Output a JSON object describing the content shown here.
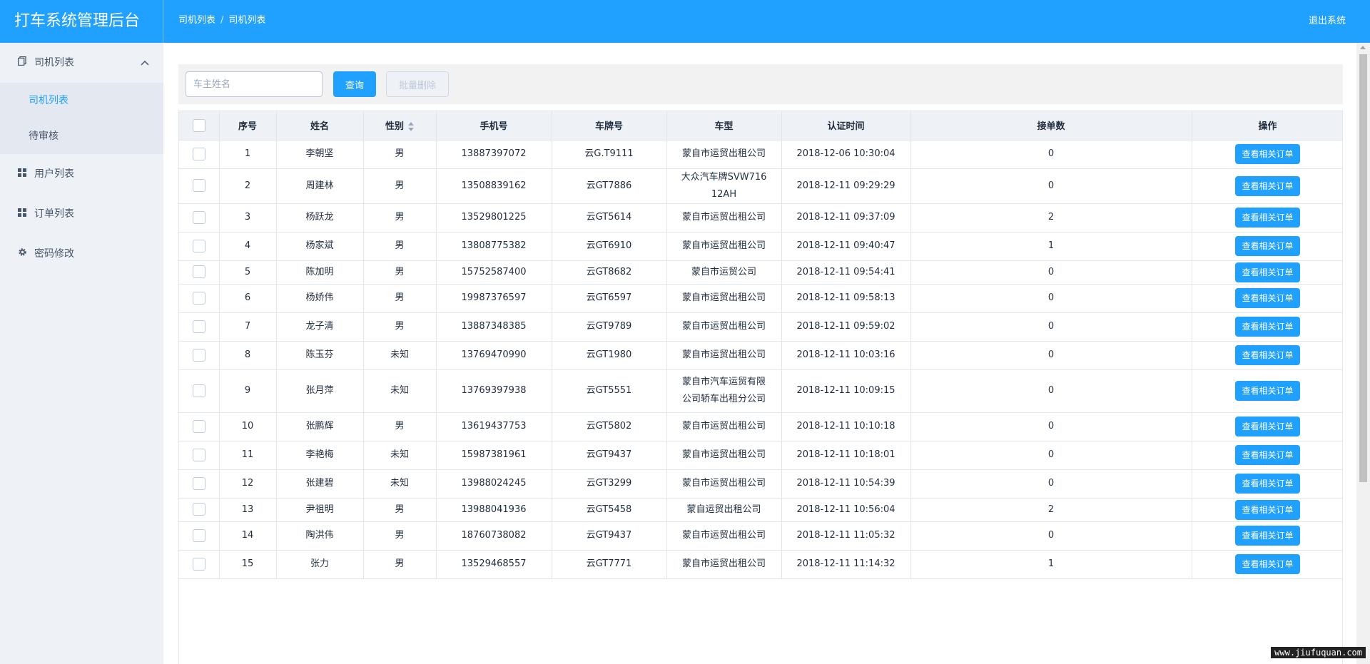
{
  "app": {
    "title": "打车系统管理后台",
    "logout": "退出系统"
  },
  "breadcrumb": [
    "司机列表",
    "司机列表"
  ],
  "sidebar": {
    "groups": [
      {
        "label": "司机列表",
        "icon": "document-icon",
        "expanded": true,
        "children": [
          {
            "label": "司机列表",
            "active": true
          },
          {
            "label": "待审核",
            "active": false
          }
        ]
      },
      {
        "label": "用户列表",
        "icon": "grid-icon"
      },
      {
        "label": "订单列表",
        "icon": "grid-icon"
      },
      {
        "label": "密码修改",
        "icon": "gear-icon"
      }
    ]
  },
  "toolbar": {
    "search_placeholder": "车主姓名",
    "query_label": "查询",
    "batch_delete_label": "批量删除"
  },
  "table": {
    "columns": [
      "",
      "序号",
      "姓名",
      "性别",
      "手机号",
      "车牌号",
      "车型",
      "认证时间",
      "接单数",
      "操作"
    ],
    "action_label": "查看相关订单",
    "rows": [
      {
        "no": "1",
        "name": "李朝坚",
        "gender": "男",
        "phone": "13887397072",
        "plate": "云G.T9111",
        "car": "蒙自市运贸出租公司",
        "time": "2018-12-06 10:30:04",
        "orders": "0"
      },
      {
        "no": "2",
        "name": "周建林",
        "gender": "男",
        "phone": "13508839162",
        "plate": "云GT7886",
        "car": "大众汽车牌SVW71612AH",
        "time": "2018-12-11 09:29:29",
        "orders": "0"
      },
      {
        "no": "3",
        "name": "杨跃龙",
        "gender": "男",
        "phone": "13529801225",
        "plate": "云GT5614",
        "car": "蒙自市运贸出租公司",
        "time": "2018-12-11 09:37:09",
        "orders": "2"
      },
      {
        "no": "4",
        "name": "杨家斌",
        "gender": "男",
        "phone": "13808775382",
        "plate": "云GT6910",
        "car": "蒙自市运贸出租公司",
        "time": "2018-12-11 09:40:47",
        "orders": "1"
      },
      {
        "no": "5",
        "name": "陈加明",
        "gender": "男",
        "phone": "15752587400",
        "plate": "云GT8682",
        "car": "蒙自市运贸公司",
        "time": "2018-12-11 09:54:41",
        "orders": "0"
      },
      {
        "no": "6",
        "name": "杨娇伟",
        "gender": "男",
        "phone": "19987376597",
        "plate": "云GT6597",
        "car": "蒙自市运贸出租公司",
        "time": "2018-12-11 09:58:13",
        "orders": "0"
      },
      {
        "no": "7",
        "name": "龙子清",
        "gender": "男",
        "phone": "13887348385",
        "plate": "云GT9789",
        "car": "蒙自市运贸出租公司",
        "time": "2018-12-11 09:59:02",
        "orders": "0"
      },
      {
        "no": "8",
        "name": "陈玉芬",
        "gender": "未知",
        "phone": "13769470990",
        "plate": "云GT1980",
        "car": "蒙自市运贸出租公司",
        "time": "2018-12-11 10:03:16",
        "orders": "0"
      },
      {
        "no": "9",
        "name": "张月萍",
        "gender": "未知",
        "phone": "13769397938",
        "plate": "云GT5551",
        "car": "蒙自市汽车运贸有限公司轿车出租分公司",
        "time": "2018-12-11 10:09:15",
        "orders": "0"
      },
      {
        "no": "10",
        "name": "张鹏辉",
        "gender": "男",
        "phone": "13619437753",
        "plate": "云GT5802",
        "car": "蒙自市运贸出租公司",
        "time": "2018-12-11 10:10:18",
        "orders": "0"
      },
      {
        "no": "11",
        "name": "李艳梅",
        "gender": "未知",
        "phone": "15987381961",
        "plate": "云GT9437",
        "car": "蒙自市运贸出租公司",
        "time": "2018-12-11 10:18:01",
        "orders": "0"
      },
      {
        "no": "12",
        "name": "张建碧",
        "gender": "未知",
        "phone": "13988024245",
        "plate": "云GT3299",
        "car": "蒙自市运贸出租公司",
        "time": "2018-12-11 10:54:39",
        "orders": "0"
      },
      {
        "no": "13",
        "name": "尹祖明",
        "gender": "男",
        "phone": "13988041936",
        "plate": "云GT5458",
        "car": "蒙自运贸出租公司",
        "time": "2018-12-11 10:56:04",
        "orders": "2"
      },
      {
        "no": "14",
        "name": "陶洪伟",
        "gender": "男",
        "phone": "18760738082",
        "plate": "云GT9437",
        "car": "蒙自市运贸出租公司",
        "time": "2018-12-11 11:05:32",
        "orders": "0"
      },
      {
        "no": "15",
        "name": "张力",
        "gender": "男",
        "phone": "13529468557",
        "plate": "云GT7771",
        "car": "蒙自市运贸出租公司",
        "time": "2018-12-11 11:14:32",
        "orders": "1"
      }
    ]
  },
  "watermark": "www.jiufuquan.com",
  "colors": {
    "primary": "#20a0ff",
    "sidebar_bg": "#eef1f6",
    "submenu_bg": "#e4e8f1"
  }
}
